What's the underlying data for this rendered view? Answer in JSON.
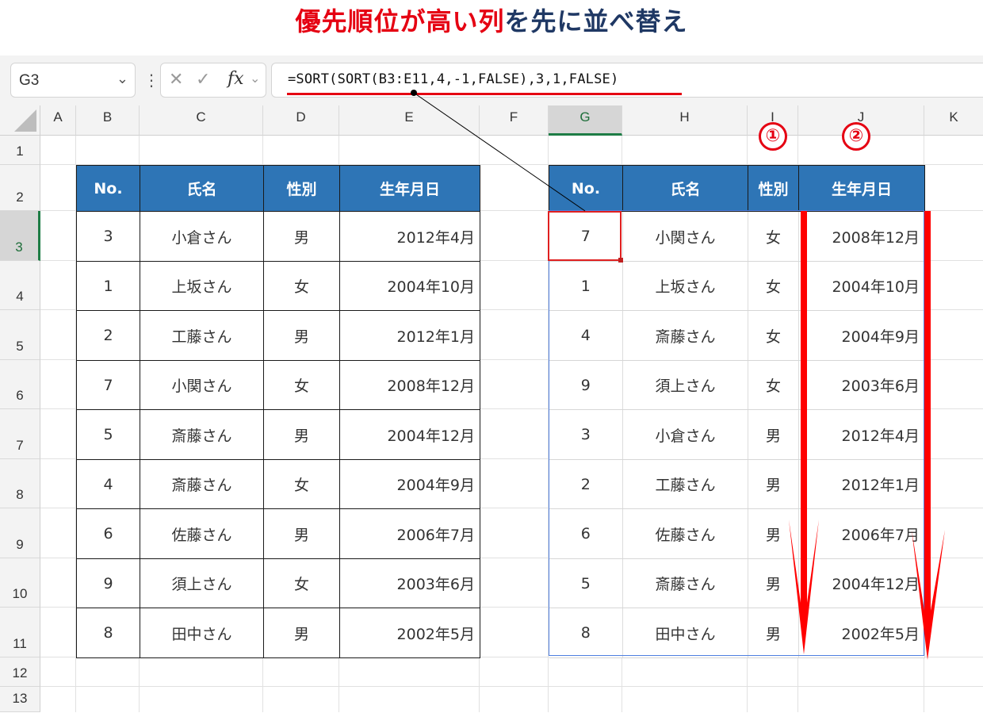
{
  "title": {
    "part1": "優先順位が高い列",
    "part2": "を先に並べ替え"
  },
  "formula_bar": {
    "name_box": "G3",
    "fx_label": "fx",
    "formula": "=SORT(SORT(B3:E11,4,-1,FALSE),3,1,FALSE)"
  },
  "columns": [
    "A",
    "B",
    "C",
    "D",
    "E",
    "F",
    "G",
    "H",
    "I",
    "J",
    "K"
  ],
  "rows": [
    "1",
    "2",
    "3",
    "4",
    "5",
    "6",
    "7",
    "8",
    "9",
    "10",
    "11",
    "12",
    "13"
  ],
  "left_table": {
    "headers": [
      "No.",
      "氏名",
      "性別",
      "生年月日"
    ],
    "rows": [
      [
        "3",
        "小倉さん",
        "男",
        "2012年4月"
      ],
      [
        "1",
        "上坂さん",
        "女",
        "2004年10月"
      ],
      [
        "2",
        "工藤さん",
        "男",
        "2012年1月"
      ],
      [
        "7",
        "小関さん",
        "女",
        "2008年12月"
      ],
      [
        "5",
        "斎藤さん",
        "男",
        "2004年12月"
      ],
      [
        "4",
        "斎藤さん",
        "女",
        "2004年9月"
      ],
      [
        "6",
        "佐藤さん",
        "男",
        "2006年7月"
      ],
      [
        "9",
        "須上さん",
        "女",
        "2003年6月"
      ],
      [
        "8",
        "田中さん",
        "男",
        "2002年5月"
      ]
    ]
  },
  "right_table": {
    "headers": [
      "No.",
      "氏名",
      "性別",
      "生年月日"
    ],
    "rows": [
      [
        "7",
        "小関さん",
        "女",
        "2008年12月"
      ],
      [
        "1",
        "上坂さん",
        "女",
        "2004年10月"
      ],
      [
        "4",
        "斎藤さん",
        "女",
        "2004年9月"
      ],
      [
        "9",
        "須上さん",
        "女",
        "2003年6月"
      ],
      [
        "3",
        "小倉さん",
        "男",
        "2012年4月"
      ],
      [
        "2",
        "工藤さん",
        "男",
        "2012年1月"
      ],
      [
        "6",
        "佐藤さん",
        "男",
        "2006年7月"
      ],
      [
        "5",
        "斎藤さん",
        "男",
        "2004年12月"
      ],
      [
        "8",
        "田中さん",
        "男",
        "2002年5月"
      ]
    ]
  },
  "markers": [
    "①",
    "②"
  ],
  "colors": {
    "header_fill": "#2e75b6",
    "accent_red": "#e50012",
    "title_blue": "#1f3864",
    "selection_green": "#1e7c45"
  }
}
